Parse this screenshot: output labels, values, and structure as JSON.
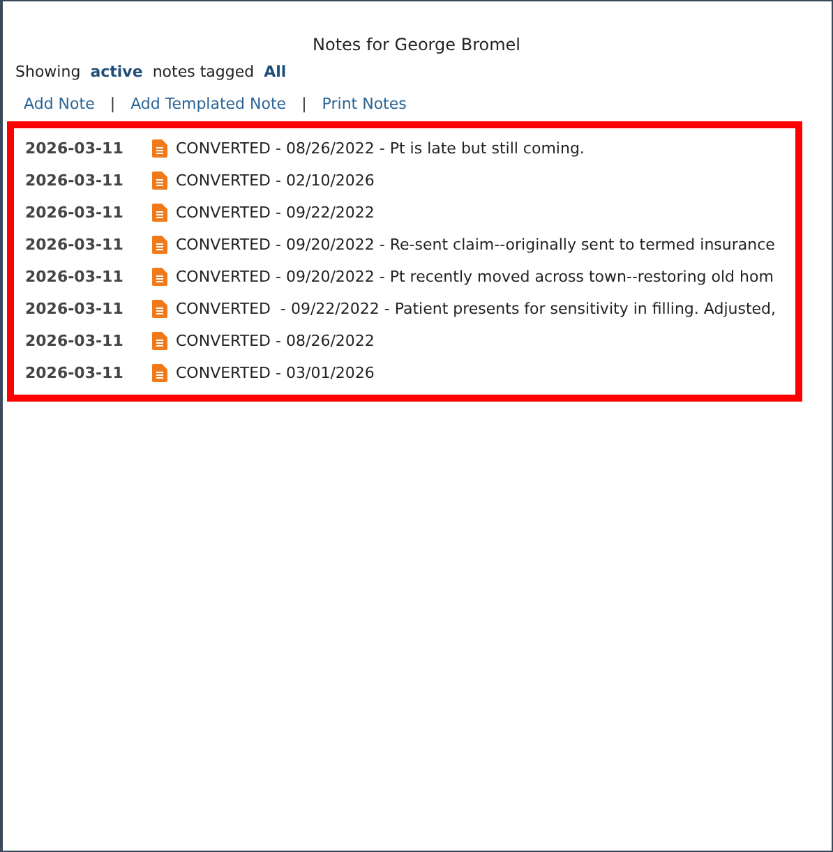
{
  "title": "Notes for George Bromel",
  "filter": {
    "prefix": "Showing",
    "status": "active",
    "middle": "notes tagged",
    "tag": "All"
  },
  "actions": [
    {
      "kind": "link",
      "label": "Add Note"
    },
    {
      "kind": "separator",
      "label": "|"
    },
    {
      "kind": "link",
      "label": "Add Templated Note"
    },
    {
      "kind": "separator",
      "label": "|"
    },
    {
      "kind": "link",
      "label": "Print Notes"
    }
  ],
  "notes": [
    {
      "date": "2026-03-11",
      "text": "CONVERTED - 08/26/2022 - Pt is late but still coming."
    },
    {
      "date": "2026-03-11",
      "text": "CONVERTED - 02/10/2026"
    },
    {
      "date": "2026-03-11",
      "text": "CONVERTED - 09/22/2022"
    },
    {
      "date": "2026-03-11",
      "text": "CONVERTED - 09/20/2022 - Re-sent claim--originally sent to termed insurance"
    },
    {
      "date": "2026-03-11",
      "text": "CONVERTED - 09/20/2022 - Pt recently moved across town--restoring old hom"
    },
    {
      "date": "2026-03-11",
      "text": "CONVERTED  - 09/22/2022 - Patient presents for sensitivity in filling. Adjusted,"
    },
    {
      "date": "2026-03-11",
      "text": "CONVERTED - 08/26/2022"
    },
    {
      "date": "2026-03-11",
      "text": "CONVERTED - 03/01/2026"
    }
  ]
}
